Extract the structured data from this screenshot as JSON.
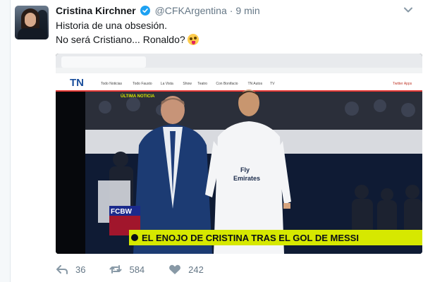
{
  "tweet": {
    "author_name": "Cristina Kirchner",
    "handle": "@CFKArgentina",
    "separator": "·",
    "time": "9 min",
    "lines": [
      "Historia de una obsesión.",
      "No será Cristiano... Ronaldo?"
    ],
    "emoji": "crazy-face-emoji",
    "verified_color": "#1da1f2"
  },
  "media": {
    "site_logo": "TN",
    "nav_items": [
      "Todo Noticias",
      "Todo Fausto",
      "La Vista",
      "Show",
      "Teatro",
      "Con Bonifacio",
      "TN Autos",
      "TV"
    ],
    "nav_right": "Twitter Apps",
    "ticker_label": "ÚLTIMA NOTICIA",
    "channel_badge": "FCBW",
    "jersey_text": "Fly\nEmirates",
    "headline": "EL ENOJO DE CRISTINA TRAS EL GOL DE MESSI",
    "accent_color": "#d6e800"
  },
  "actions": {
    "replies": "36",
    "retweets": "584",
    "likes": "242"
  }
}
